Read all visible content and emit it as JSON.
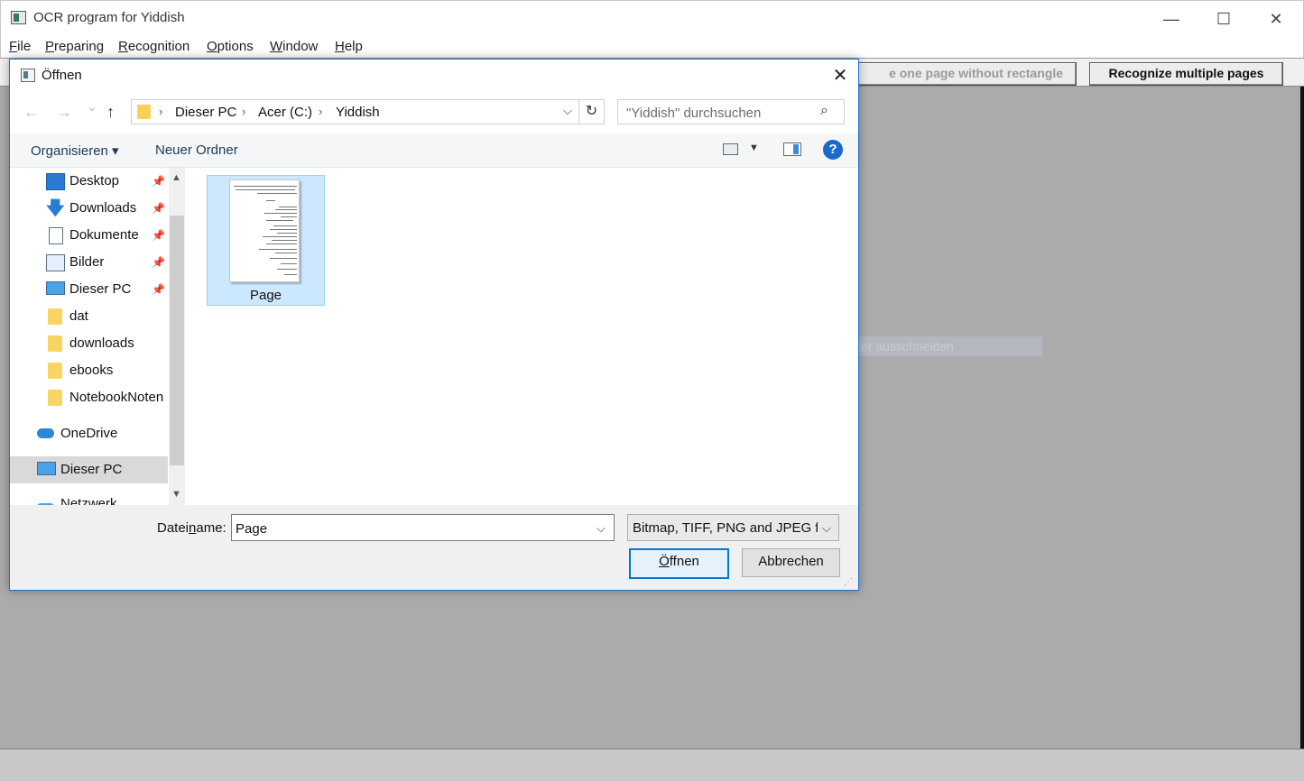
{
  "app": {
    "title": "OCR program for Yiddish",
    "window_controls": {
      "minimize": "—",
      "maximize": "☐",
      "close": "✕"
    },
    "menu": [
      {
        "label": "File",
        "accel": "F",
        "rest": "ile"
      },
      {
        "label": "Preparing",
        "accel": "P",
        "rest": "reparing"
      },
      {
        "label": "Recognition",
        "accel": "R",
        "rest": "ecognition"
      },
      {
        "label": "Options",
        "accel": "O",
        "rest": "ptions"
      },
      {
        "label": "Window",
        "accel": "W",
        "rest": "indow"
      },
      {
        "label": "Help",
        "accel": "H",
        "rest": "elp"
      }
    ],
    "toolbar": {
      "one_page_partial": "e one page without rectangle",
      "multi_pages": "Recognize multiple pages"
    },
    "ghost_tooltip": "Fenster ausschneiden"
  },
  "dialog": {
    "title": "Öffnen",
    "close": "✕",
    "nav": {
      "back": "←",
      "forward": "→",
      "recent": "⌄",
      "up": "↑"
    },
    "address": {
      "crumbs": [
        "Dieser PC",
        "Acer (C:)",
        "Yiddish"
      ],
      "separator": "›",
      "dropdown": "⌵",
      "refresh": "↻"
    },
    "search": {
      "placeholder": "\"Yiddish\" durchsuchen",
      "icon": "⌕"
    },
    "commands": {
      "organize": "Organisieren ▾",
      "new_folder": "Neuer Ordner",
      "view_drop": "▼",
      "help": "?"
    },
    "nav_pane": {
      "quick_access": [
        {
          "label": "Desktop",
          "icon": "desktop-icon",
          "pinned": true
        },
        {
          "label": "Downloads",
          "icon": "download-icon",
          "pinned": true
        },
        {
          "label": "Dokumente",
          "icon": "document-icon",
          "pinned": true
        },
        {
          "label": "Bilder",
          "icon": "pictures-icon",
          "pinned": true
        },
        {
          "label": "Dieser PC",
          "icon": "computer-icon",
          "pinned": true
        },
        {
          "label": "dat",
          "icon": "folder-icon",
          "pinned": false
        },
        {
          "label": "downloads",
          "icon": "folder-icon",
          "pinned": false
        },
        {
          "label": "ebooks",
          "icon": "folder-icon",
          "pinned": false
        },
        {
          "label": "NotebookNoten",
          "icon": "folder-icon",
          "pinned": false
        }
      ],
      "onedrive": "OneDrive",
      "this_pc": "Dieser PC",
      "network": "Netzwerk",
      "pin_glyph": "📌",
      "scroll_up": "▲",
      "scroll_down": "▼"
    },
    "files": [
      {
        "name": "Page",
        "selected": true
      }
    ],
    "bottom": {
      "filename_label_pre": "Datei",
      "filename_label_accel": "n",
      "filename_label_post": "ame:",
      "filename_value": "Page",
      "filename_drop": "⌵",
      "filter_label": "Bitmap, TIFF, PNG and JPEG files",
      "filter_drop": "⌵",
      "open_accel": "Ö",
      "open_rest": "ffnen",
      "cancel_label": "Abbrechen",
      "grip": "⋰"
    }
  },
  "colors": {
    "accent": "#0078d7",
    "selection": "#cce8ff",
    "workspace": "#ababab"
  }
}
